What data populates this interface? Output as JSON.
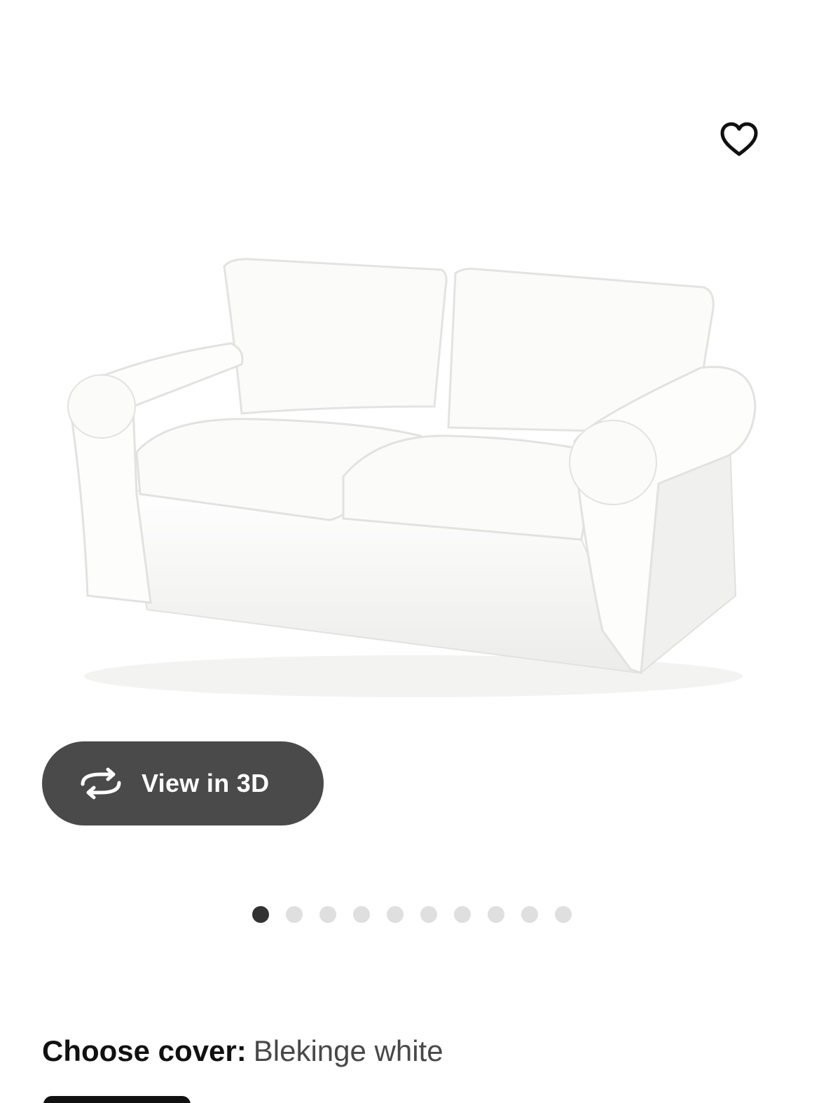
{
  "product": {
    "image_name": "sofa-product-image",
    "favorite_icon": "heart-outline-icon"
  },
  "view3d": {
    "label": "View in 3D",
    "icon": "rotate-3d-icon",
    "background": "#4a4a4a"
  },
  "carousel": {
    "total": 10,
    "active_index": 0,
    "active_color": "#333333",
    "inactive_color": "#dfdfdf"
  },
  "cover": {
    "label": "Choose cover:",
    "value": "Blekinge white"
  }
}
